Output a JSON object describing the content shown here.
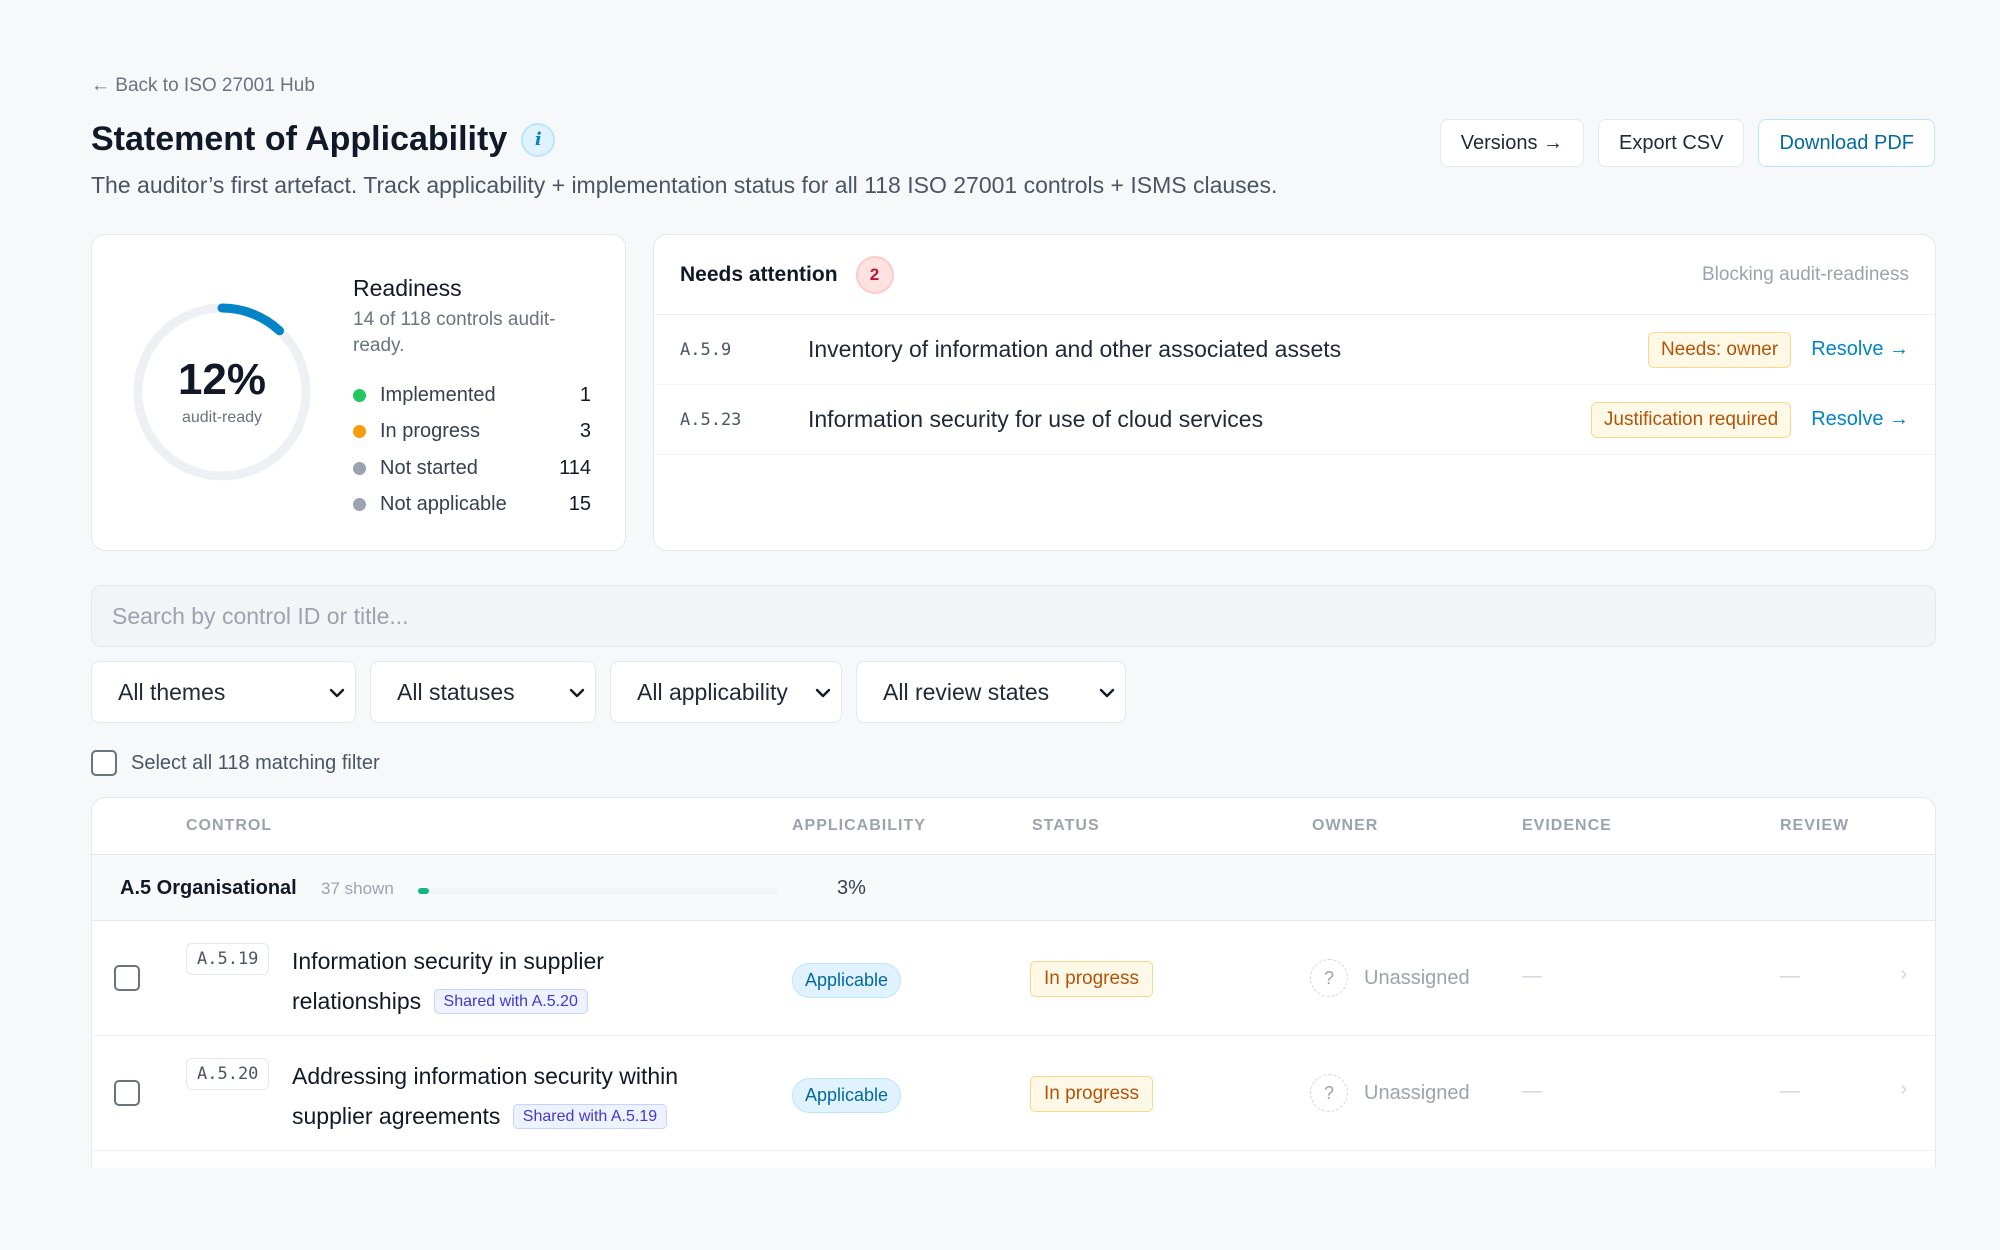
{
  "back_link": "← Back to ISO 27001 Hub",
  "title": "Statement of Applicability",
  "info_glyph": "i",
  "subtitle": "The auditor’s first artefact. Track applicability + implementation status for all 118 ISO 27001 controls + ISMS clauses.",
  "actions": {
    "versions": "Versions →",
    "export_csv": "Export CSV",
    "download_pdf": "Download PDF"
  },
  "readiness": {
    "percent_label": "12%",
    "percent_value": 0.12,
    "caption": "audit-ready",
    "title": "Readiness",
    "summary": "14 of 118 controls audit-ready.",
    "legend": [
      {
        "label": "Implemented",
        "count": "1",
        "color": "#22c55e"
      },
      {
        "label": "In progress",
        "count": "3",
        "color": "#f59e0b"
      },
      {
        "label": "Not started",
        "count": "114",
        "color": "#9ca3af"
      },
      {
        "label": "Not applicable",
        "count": "15",
        "color": "#9ca3af"
      }
    ],
    "ring_color": "#0284c7",
    "track_color": "#eef0f4"
  },
  "attention": {
    "title": "Needs attention",
    "count": "2",
    "meta": "Blocking audit-readiness",
    "items": [
      {
        "id": "A.5.9",
        "text": "Inventory of information and other associated assets",
        "tag": "Needs: owner",
        "action": "Resolve →"
      },
      {
        "id": "A.5.23",
        "text": "Information security for use of cloud services",
        "tag": "Justification required",
        "action": "Resolve →"
      }
    ]
  },
  "search": {
    "placeholder": "Search by control ID or title..."
  },
  "filters": {
    "themes": "All themes",
    "statuses": "All statuses",
    "applicability": "All applicability",
    "review": "All review states",
    "chevron_icon": "chevron-down-icon"
  },
  "select_all": "Select all 118 matching filter",
  "table": {
    "columns": {
      "control": "CONTROL",
      "applicability": "APPLICABILITY",
      "status": "STATUS",
      "owner": "OWNER",
      "evidence": "EVIDENCE",
      "review": "REVIEW"
    },
    "group": {
      "name": "A.5 Organisational",
      "count": "37 shown",
      "progress_label": "3%",
      "progress_value": 0.03
    },
    "rows": [
      {
        "id": "A.5.19",
        "title": "Information security in supplier relationships",
        "shared": "Shared with A.5.20",
        "applicability": "Applicable",
        "status": "In progress",
        "owner_avatar": "?",
        "owner": "Unassigned",
        "evidence": "—",
        "review": "—",
        "chevron": "›"
      },
      {
        "id": "A.5.20",
        "title": "Addressing information security within supplier agreements",
        "shared": "Shared with A.5.19",
        "applicability": "Applicable",
        "status": "In progress",
        "owner_avatar": "?",
        "owner": "Unassigned",
        "evidence": "—",
        "review": "—",
        "chevron": "›"
      }
    ]
  }
}
